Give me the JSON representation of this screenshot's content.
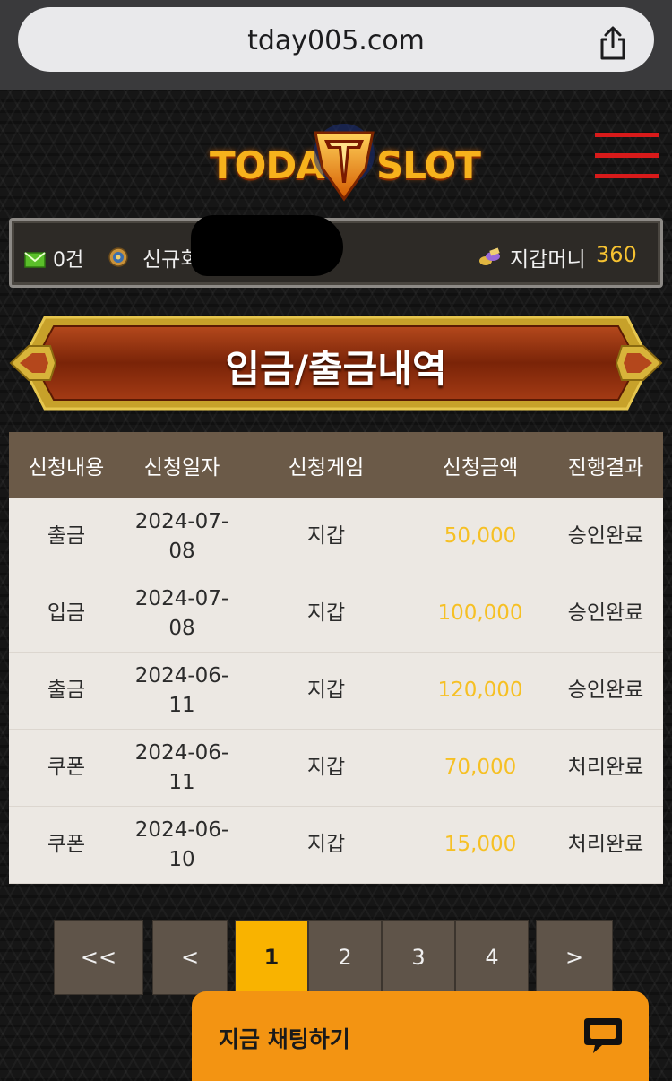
{
  "browser": {
    "url": "tday005.com"
  },
  "header": {
    "logo_left": "TODAY",
    "logo_right": "SLOT"
  },
  "info_bar": {
    "message_count": "0건",
    "user_label": "신규회",
    "wallet_label": "지갑머니",
    "wallet_value": "360"
  },
  "page": {
    "title": "입금/출금내역"
  },
  "table": {
    "headers": [
      "신청내용",
      "신청일자",
      "신청게임",
      "신청금액",
      "진행결과"
    ],
    "rows": [
      [
        "출금",
        "2024-07-08",
        "지갑",
        "50,000",
        "승인완료"
      ],
      [
        "입금",
        "2024-07-08",
        "지갑",
        "100,000",
        "승인완료"
      ],
      [
        "출금",
        "2024-06-11",
        "지갑",
        "120,000",
        "승인완료"
      ],
      [
        "쿠폰",
        "2024-06-11",
        "지갑",
        "70,000",
        "처리완료"
      ],
      [
        "쿠폰",
        "2024-06-10",
        "지갑",
        "15,000",
        "처리완료"
      ]
    ]
  },
  "pagination": {
    "first": "<<",
    "prev": "<",
    "pages": [
      "1",
      "2",
      "3",
      "4"
    ],
    "next": ">",
    "current": "1"
  },
  "chat": {
    "label": "지금 채팅하기"
  },
  "colors": {
    "accent": "#f6c024",
    "header_row": "#6b5a48",
    "chat": "#f39412",
    "menu": "#d81a1a"
  }
}
